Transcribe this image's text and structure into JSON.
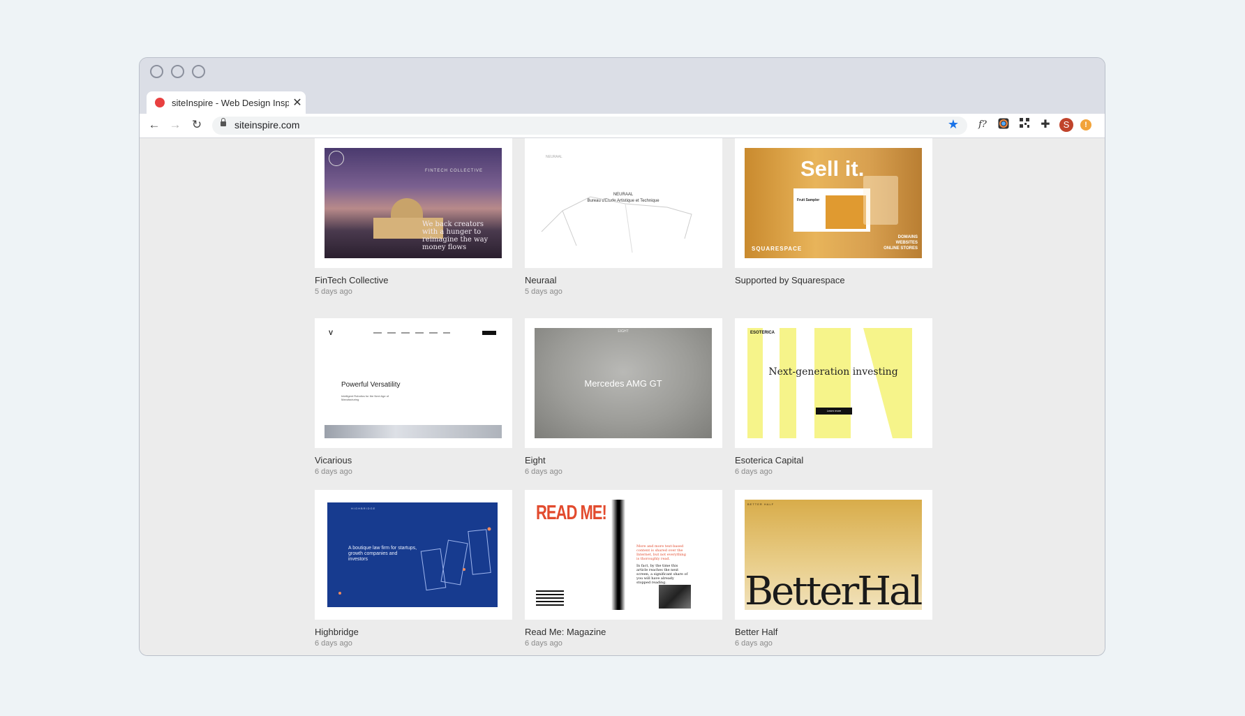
{
  "browser": {
    "tab_title": "siteInspire - Web Design Inspiration",
    "tab_close": "✕",
    "new_tab": "+",
    "url": "siteinspire.com",
    "avatar_letter": "S",
    "extension_fx": "f?",
    "colors": {
      "favicon": "#e84040",
      "star": "#1a73e8",
      "avatar": "#c0432b",
      "alert": "#f2a33a"
    }
  },
  "gallery": {
    "cards": [
      {
        "title": "FinTech Collective",
        "date": "5 days ago",
        "thumb": {
          "brand": "FINTECH COLLECTIVE",
          "headline": "We back creators with a hunger to reimagine the way money flows"
        }
      },
      {
        "title": "Neuraal",
        "date": "5 days ago",
        "thumb": {
          "logo": "NEURAAL",
          "brand": "NEURAAL",
          "tagline": "Bureau d'Etude Artistique et Technique"
        }
      },
      {
        "title": "Supported by Squarespace",
        "date": "",
        "thumb": {
          "headline": "Sell it.",
          "product": "Fruit Sampler",
          "brand": "SQUARESPACE",
          "side": "DOMAINS\nWEBSITES\nONLINE STORES"
        }
      },
      {
        "title": "Vicarious",
        "date": "6 days ago",
        "thumb": {
          "logo": "V",
          "headline": "Powerful Versatility",
          "sub": "Intelligent Robotics for the Next Age of Manufacturing"
        }
      },
      {
        "title": "Eight",
        "date": "6 days ago",
        "thumb": {
          "logo": "EIGHT",
          "headline": "Mercedes AMG GT"
        }
      },
      {
        "title": "Esoterica Capital",
        "date": "6 days ago",
        "thumb": {
          "logo": "ESOTERICA",
          "headline": "Next-generation investing",
          "button": "Learn more"
        }
      },
      {
        "title": "Highbridge",
        "date": "6 days ago",
        "thumb": {
          "logo": "HIGHBRIDGE",
          "headline": "A boutique law firm for startups, growth companies and investors"
        }
      },
      {
        "title": "Read Me: Magazine",
        "date": "6 days ago",
        "thumb": {
          "logo": "READ ME!",
          "body_red": "More and more text-based content is shared over the Internet, but not everything is thoroughly read.",
          "body_black": "In fact, by the time this article reaches the next screen, a significant share of you will have already stopped reading."
        }
      },
      {
        "title": "Better Half",
        "date": "6 days ago",
        "thumb": {
          "logo": "BETTER HALF",
          "headline": "BetterHalf"
        }
      }
    ]
  }
}
